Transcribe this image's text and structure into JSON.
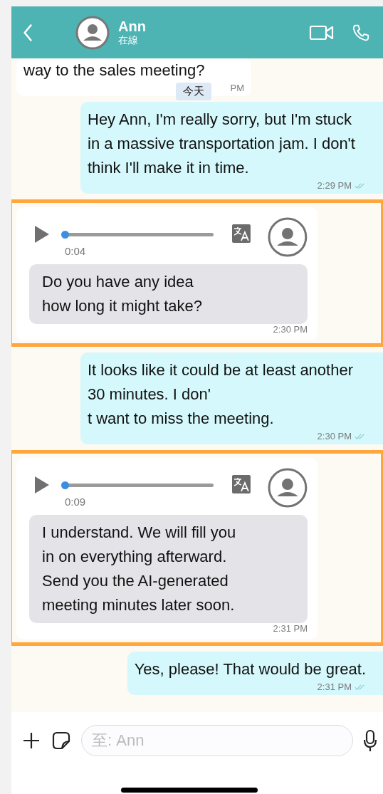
{
  "header": {
    "contact_name": "Ann",
    "status": "在線"
  },
  "date_chip": "今天",
  "messages": [
    {
      "kind": "received",
      "text": "way to the sales meeting?",
      "time": "PM",
      "highlighted": false
    },
    {
      "kind": "sent",
      "text": "Hey Ann, I'm really sorry, but I'm stuck in a massive transportation jam. I don't think I'll make it in time.",
      "time": "2:29 PM",
      "read": true,
      "highlighted": false
    },
    {
      "kind": "voice",
      "duration": "0:04",
      "level": 0,
      "transcript": " Do you have any idea\nhow long it might take?",
      "time": "2:30 PM",
      "highlighted": true
    },
    {
      "kind": "sent",
      "text": "It looks like it could be at least another 30 minutes. I don'\nt want to miss the meeting.",
      "time": "2:30 PM",
      "read": true,
      "highlighted": false
    },
    {
      "kind": "voice",
      "duration": "0:09",
      "level": 0,
      "transcript": " I understand. We will fill you\nin on everything afterward.\nSend you the AI-generated\nmeeting minutes later soon.",
      "time": "2:31 PM",
      "highlighted": true
    },
    {
      "kind": "sent",
      "text": "Yes, please! That would be great.",
      "time": "2:31 PM",
      "read": true,
      "highlighted": false
    }
  ],
  "composer": {
    "placeholder": "至: Ann"
  }
}
